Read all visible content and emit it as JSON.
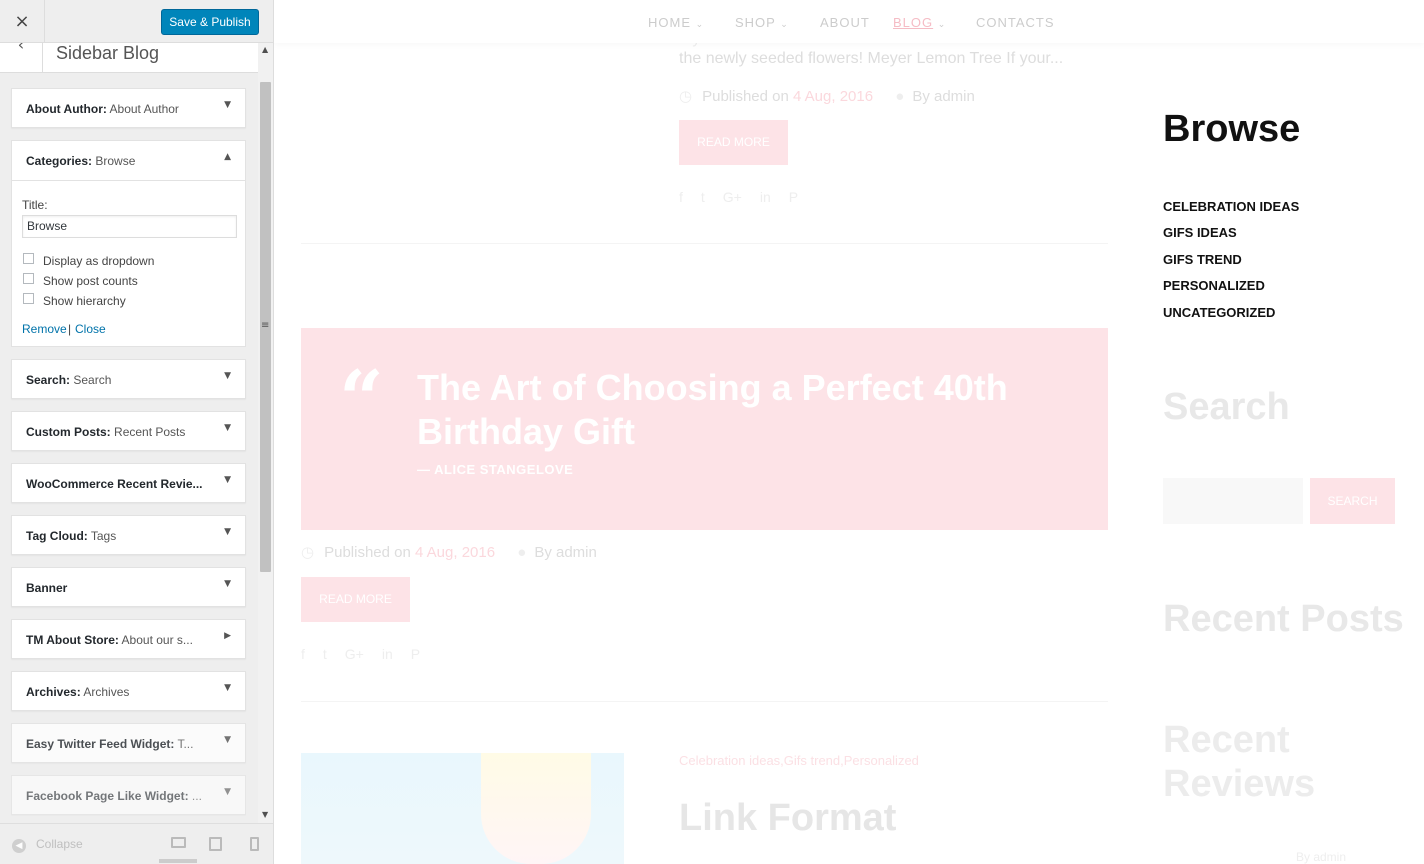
{
  "customizer": {
    "close_icon": "×",
    "save_label": "Save & Publish",
    "back_icon": "‹",
    "section_title": "Sidebar Blog",
    "widgets": [
      {
        "name": "About Author:",
        "sub": " About Author",
        "state": "collapsed"
      },
      {
        "name": "Categories:",
        "sub": " Browse",
        "state": "expanded"
      },
      {
        "name": "Search:",
        "sub": " Search",
        "state": "collapsed"
      },
      {
        "name": "Custom Posts:",
        "sub": " Recent Posts",
        "state": "collapsed"
      },
      {
        "name": "WooCommerce Recent Revie...",
        "sub": "",
        "state": "collapsed"
      },
      {
        "name": "Tag Cloud:",
        "sub": " Tags",
        "state": "collapsed"
      },
      {
        "name": "Banner",
        "sub": "",
        "state": "collapsed"
      },
      {
        "name": "TM About Store:",
        "sub": " About our s...",
        "state": "collapsed"
      },
      {
        "name": "Archives:",
        "sub": " Archives",
        "state": "collapsed"
      },
      {
        "name": "Easy Twitter Feed Widget:",
        "sub": " T...",
        "state": "collapsed"
      },
      {
        "name": "Facebook Page Like Widget:",
        "sub": " ...",
        "state": "collapsed"
      }
    ],
    "categories_form": {
      "title_label": "Title:",
      "title_value": "Browse",
      "checkboxes": [
        "Display as dropdown",
        "Show post counts",
        "Show hierarchy"
      ],
      "remove_label": "Remove",
      "separator": "|",
      "close_label": "Close"
    },
    "footer": {
      "collapse_label": "Collapse"
    }
  },
  "preview": {
    "nav": [
      "HOME",
      "SHOP",
      "ABOUT",
      "BLOG",
      "CONTACTS"
    ],
    "nav_active": "BLOG",
    "post1": {
      "excerpt_line1": "...y",
      "excerpt_line2": "the newly seeded flowers! Meyer Lemon Tree If your...",
      "published_prefix": "Published on",
      "date": "4 Aug, 2016",
      "by": "By admin",
      "read_more": "READ MORE"
    },
    "quote_post": {
      "title": "The Art of Choosing a Perfect 40th Birthday Gift",
      "author": "— ALICE STANGELOVE",
      "published_prefix": "Published on",
      "date": "4 Aug, 2016",
      "by": "By admin",
      "read_more": "READ MORE"
    },
    "post3": {
      "categories": "Celebration ideas,Gifs trend,Personalized",
      "title": "Link Format",
      "by": "By admin"
    },
    "sidebar": {
      "browse_title": "Browse",
      "categories": [
        "CELEBRATION IDEAS",
        "GIFS IDEAS",
        "GIFS TREND",
        "PERSONALIZED",
        "UNCATEGORIZED"
      ],
      "search_title": "Search",
      "search_button": "SEARCH",
      "recent_posts_title": "Recent Posts",
      "recent_reviews_title": "Recent Reviews"
    },
    "social_icons": [
      "facebook-icon",
      "twitter-icon",
      "google-plus-icon",
      "linkedin-icon",
      "pinterest-icon"
    ]
  }
}
